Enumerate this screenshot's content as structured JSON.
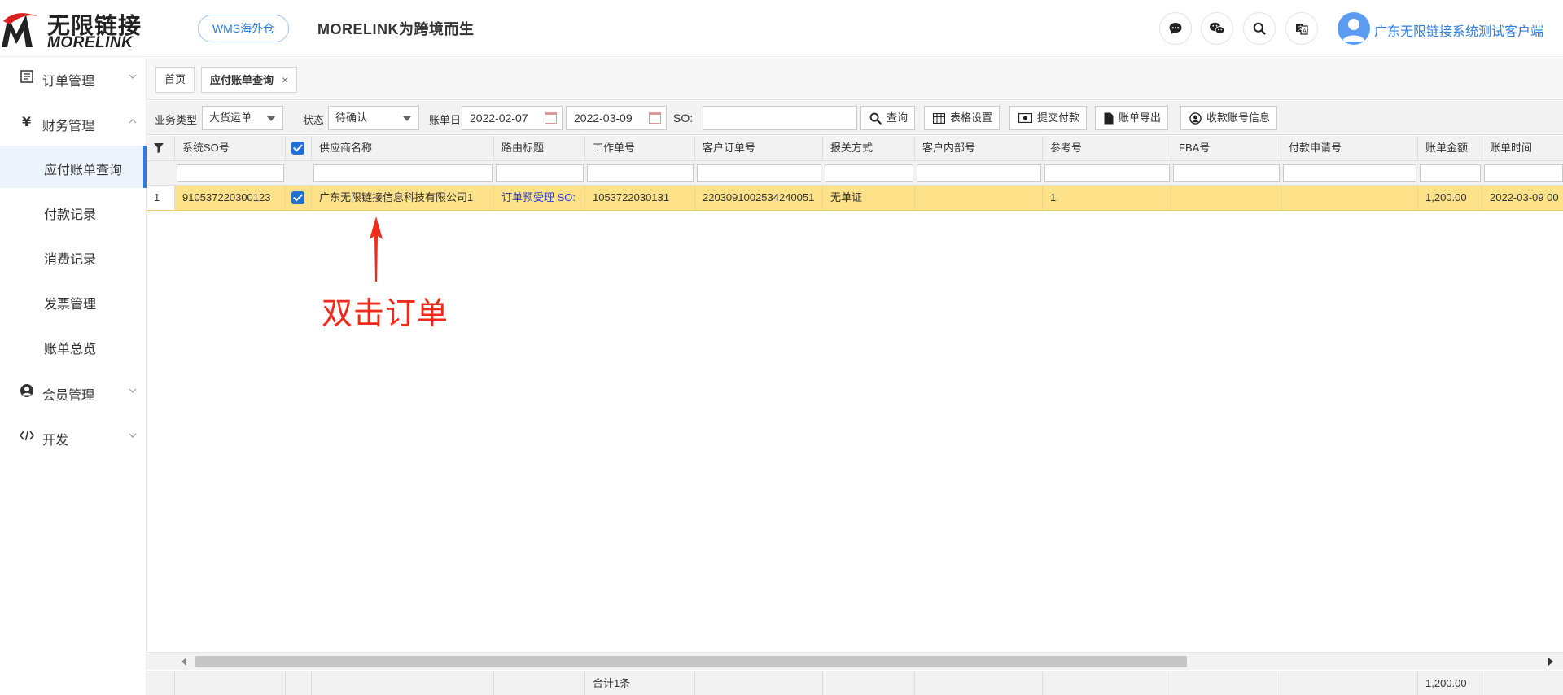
{
  "header": {
    "logo_cn": "无限链接",
    "logo_en": "MORELINK",
    "wms_button": "WMS海外仓",
    "slogan": "MORELINK为跨境而生",
    "user_name": "广东无限链接系统测试客户端",
    "icons": [
      "message-icon",
      "wechat-icon",
      "search-icon",
      "translate-icon"
    ],
    "accent": "#2f7de1"
  },
  "sidebar": {
    "groups": [
      {
        "label": "订单管理",
        "icon": "order-icon",
        "expanded": false
      },
      {
        "label": "财务管理",
        "icon": "yen-icon",
        "expanded": true
      },
      {
        "label": "会员管理",
        "icon": "user-icon",
        "expanded": false
      },
      {
        "label": "开发",
        "icon": "code-icon",
        "expanded": false
      }
    ],
    "finance_items": [
      "应付账单查询",
      "付款记录",
      "消费记录",
      "发票管理",
      "账单总览"
    ],
    "active_item": "应付账单查询"
  },
  "tabs": [
    {
      "label": "首页"
    },
    {
      "label": "应付账单查询",
      "close": "×"
    }
  ],
  "filter": {
    "business_type_label": "业务类型",
    "business_type_value": "大货运单",
    "status_label": "状态",
    "status_value": "待确认",
    "bill_date_label": "账单日",
    "date_from": "2022-02-07",
    "date_to": "2022-03-09",
    "so_label": "SO:",
    "so_value": "",
    "buttons": {
      "query": "查询",
      "table_settings": "表格设置",
      "submit_payment": "提交付款",
      "export_bill": "账单导出",
      "account_info": "收款账号信息"
    }
  },
  "grid": {
    "columns": [
      "系统SO号",
      "供应商名称",
      "路由标题",
      "工作单号",
      "客户订单号",
      "报关方式",
      "客户内部号",
      "参考号",
      "FBA号",
      "付款申请号",
      "账单金额",
      "账单时间"
    ],
    "rows": [
      {
        "index": "1",
        "so": "910537220300123",
        "supplier": "广东无限链接信息科技有限公司1",
        "route": "订单预受理 SO:",
        "work_no": "1053722030131",
        "customer_order": "2203091002534240051",
        "customs": "无单证",
        "internal_no": "",
        "ref": "1",
        "fba": "",
        "payment_no": "",
        "amount": "1,200.00",
        "bill_time": "2022-03-09 00"
      }
    ],
    "footer": {
      "total_label": "合计1条",
      "total_amount": "1,200.00"
    },
    "row_highlight": "#fde28a"
  },
  "annotation": {
    "text": "双击订单",
    "color": "#f02a1a"
  }
}
